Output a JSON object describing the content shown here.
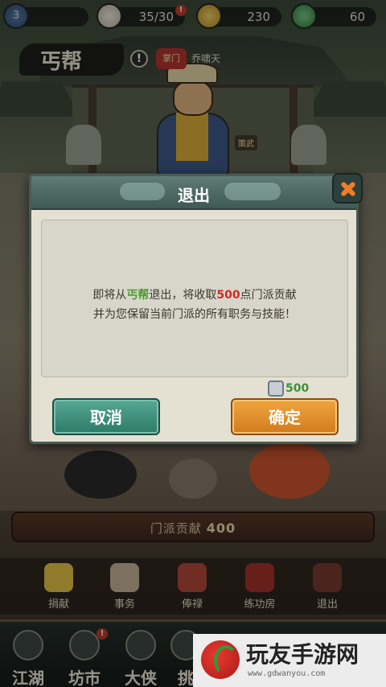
{
  "topbar": {
    "level": "3",
    "stamina": "35/30",
    "stamina_badge": "!",
    "coins": "230",
    "jade": "60"
  },
  "sect": {
    "name": "丐帮",
    "info_icon": "!",
    "leader_tag": "掌门",
    "leader_name": "乔啸天",
    "strategy_tag": "策武"
  },
  "contribution": {
    "label": "门派贡献",
    "value": "400"
  },
  "actions": [
    {
      "label": "捐献"
    },
    {
      "label": "事务"
    },
    {
      "label": "俸禄"
    },
    {
      "label": "练功房"
    },
    {
      "label": "退出"
    }
  ],
  "bottomnav": [
    {
      "label": "江湖"
    },
    {
      "label": "坊市"
    },
    {
      "label": "大侠"
    },
    {
      "label": "挑"
    }
  ],
  "dialog": {
    "title": "退出",
    "line1_prefix": "即将从",
    "line1_sect": "丐帮",
    "line1_mid": "退出，将收取",
    "line1_amount": "500",
    "line1_suffix": "点门派贡献",
    "line2": "并为您保留当前门派的所有职务与技能！",
    "cost": "500",
    "cancel_label": "取消",
    "confirm_label": "确定"
  },
  "watermark": {
    "title": "玩友手游网",
    "url": "www.gdwanyou.com"
  },
  "colors": {
    "confirm": "#e08d2c",
    "cancel": "#3f8f7c",
    "highlight_green": "#4a9a2a",
    "highlight_red": "#d42a20"
  }
}
